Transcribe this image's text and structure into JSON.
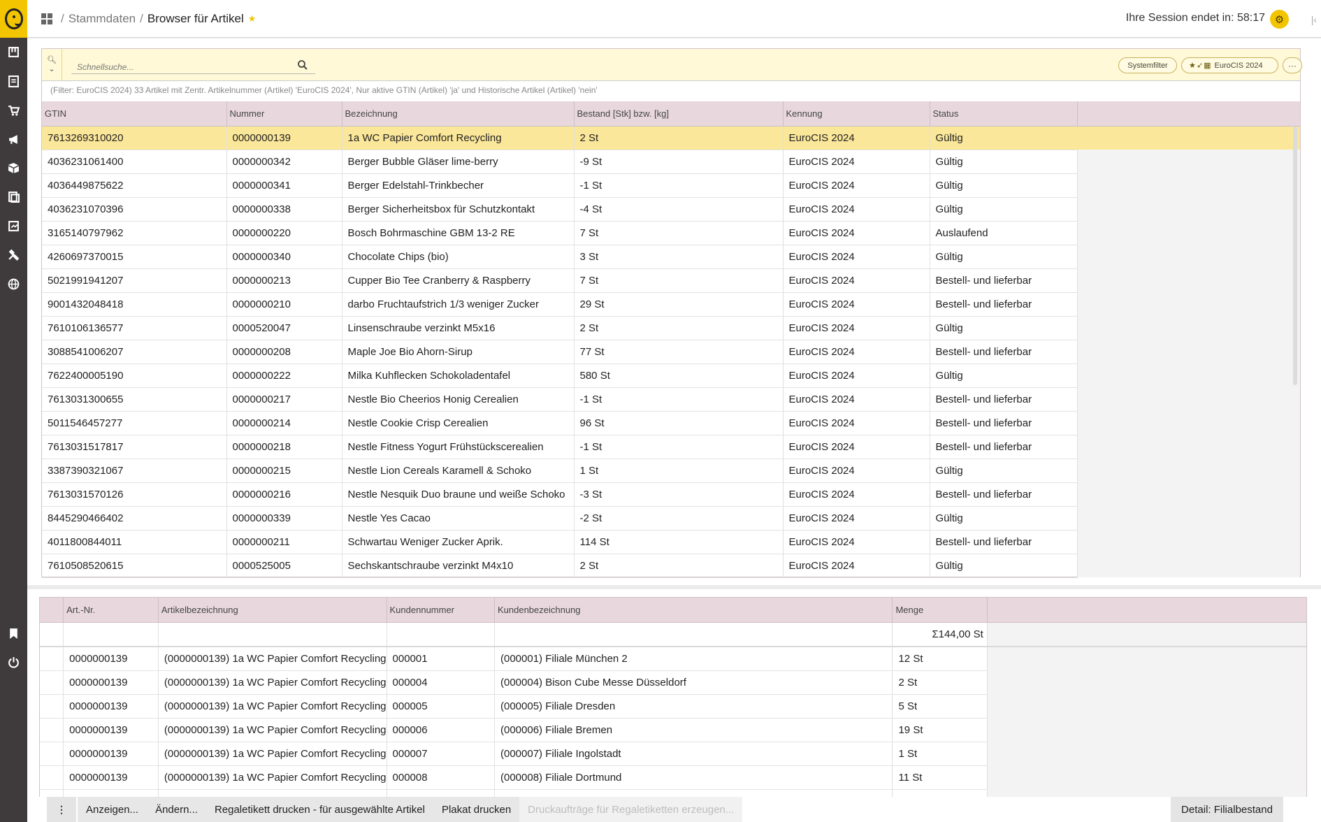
{
  "breadcrumb": {
    "section": "Stammdaten",
    "current": "Browser für Artikel"
  },
  "session": {
    "label": "Ihre Session endet in: 58:17"
  },
  "search": {
    "placeholder": "Schnellsuche..."
  },
  "filter_chips": {
    "systemfilter": "Systemfilter",
    "saved_filter": "EuroCIS 2024",
    "more": "···"
  },
  "filter_info": "(Filter: EuroCIS 2024) 33 Artikel mit Zentr. Artikelnummer (Artikel) 'EuroCIS 2024', Nur aktive GTIN (Artikel) 'ja' und Historische Artikel (Artikel) 'nein'",
  "articles": {
    "columns": [
      "GTIN",
      "Nummer",
      "Bezeichnung",
      "Bestand [Stk] bzw. [kg]",
      "Kennung",
      "Status"
    ],
    "rows": [
      {
        "gtin": "7613269310020",
        "nummer": "0000000139",
        "bezeichnung": "1a WC Papier Comfort Recycling",
        "bestand": "2 St",
        "kennung": "EuroCIS 2024",
        "status": "Gültig"
      },
      {
        "gtin": "4036231061400",
        "nummer": "0000000342",
        "bezeichnung": "Berger Bubble Gläser lime-berry",
        "bestand": "-9 St",
        "kennung": "EuroCIS 2024",
        "status": "Gültig"
      },
      {
        "gtin": "4036449875622",
        "nummer": "0000000341",
        "bezeichnung": "Berger Edelstahl-Trinkbecher",
        "bestand": "-1 St",
        "kennung": "EuroCIS 2024",
        "status": "Gültig"
      },
      {
        "gtin": "4036231070396",
        "nummer": "0000000338",
        "bezeichnung": "Berger Sicherheitsbox für Schutzkontakt",
        "bestand": "-4 St",
        "kennung": "EuroCIS 2024",
        "status": "Gültig"
      },
      {
        "gtin": "3165140797962",
        "nummer": "0000000220",
        "bezeichnung": "Bosch Bohrmaschine GBM 13-2 RE",
        "bestand": "7 St",
        "kennung": "EuroCIS 2024",
        "status": "Auslaufend"
      },
      {
        "gtin": "4260697370015",
        "nummer": "0000000340",
        "bezeichnung": "Chocolate Chips (bio)",
        "bestand": "3 St",
        "kennung": "EuroCIS 2024",
        "status": "Gültig"
      },
      {
        "gtin": "5021991941207",
        "nummer": "0000000213",
        "bezeichnung": "Cupper Bio Tee Cranberry & Raspberry",
        "bestand": "7 St",
        "kennung": "EuroCIS 2024",
        "status": "Bestell- und lieferbar"
      },
      {
        "gtin": "9001432048418",
        "nummer": "0000000210",
        "bezeichnung": "darbo Fruchtaufstrich 1/3 weniger Zucker",
        "bestand": "29 St",
        "kennung": "EuroCIS 2024",
        "status": "Bestell- und lieferbar"
      },
      {
        "gtin": "7610106136577",
        "nummer": "0000520047",
        "bezeichnung": "Linsenschraube verzinkt M5x16",
        "bestand": "2 St",
        "kennung": "EuroCIS 2024",
        "status": "Gültig"
      },
      {
        "gtin": "3088541006207",
        "nummer": "0000000208",
        "bezeichnung": "Maple Joe Bio Ahorn-Sirup",
        "bestand": "77 St",
        "kennung": "EuroCIS 2024",
        "status": "Bestell- und lieferbar"
      },
      {
        "gtin": "7622400005190",
        "nummer": "0000000222",
        "bezeichnung": "Milka Kuhflecken Schokoladentafel",
        "bestand": "580 St",
        "kennung": "EuroCIS 2024",
        "status": "Gültig"
      },
      {
        "gtin": "7613031300655",
        "nummer": "0000000217",
        "bezeichnung": "Nestle Bio Cheerios Honig Cerealien",
        "bestand": "-1 St",
        "kennung": "EuroCIS 2024",
        "status": "Bestell- und lieferbar"
      },
      {
        "gtin": "5011546457277",
        "nummer": "0000000214",
        "bezeichnung": "Nestle Cookie Crisp Cerealien",
        "bestand": "96 St",
        "kennung": "EuroCIS 2024",
        "status": "Bestell- und lieferbar"
      },
      {
        "gtin": "7613031517817",
        "nummer": "0000000218",
        "bezeichnung": "Nestle Fitness Yogurt Frühstückscerealien",
        "bestand": "-1 St",
        "kennung": "EuroCIS 2024",
        "status": "Bestell- und lieferbar"
      },
      {
        "gtin": "3387390321067",
        "nummer": "0000000215",
        "bezeichnung": "Nestle Lion Cereals Karamell & Schoko",
        "bestand": "1 St",
        "kennung": "EuroCIS 2024",
        "status": "Gültig"
      },
      {
        "gtin": "7613031570126",
        "nummer": "0000000216",
        "bezeichnung": "Nestle Nesquik Duo braune und weiße Schoko",
        "bestand": "-3 St",
        "kennung": "EuroCIS 2024",
        "status": "Bestell- und lieferbar"
      },
      {
        "gtin": "8445290466402",
        "nummer": "0000000339",
        "bezeichnung": "Nestle Yes Cacao",
        "bestand": "-2 St",
        "kennung": "EuroCIS 2024",
        "status": "Gültig"
      },
      {
        "gtin": "4011800844011",
        "nummer": "0000000211",
        "bezeichnung": "Schwartau Weniger Zucker Aprik.",
        "bestand": "114 St",
        "kennung": "EuroCIS 2024",
        "status": "Bestell- und lieferbar"
      },
      {
        "gtin": "7610508520615",
        "nummer": "0000525005",
        "bezeichnung": "Sechskantschraube verzinkt M4x10",
        "bestand": "2 St",
        "kennung": "EuroCIS 2024",
        "status": "Gültig"
      }
    ]
  },
  "detail": {
    "columns": [
      "",
      "Art.-Nr.",
      "Artikelbezeichnung",
      "Kundennummer",
      "Kundenbezeichnung",
      "Menge"
    ],
    "total": "Σ144,00 St",
    "rows": [
      {
        "artnr": "0000000139",
        "artikel": "(0000000139) 1a WC Papier Comfort Recycling",
        "kdnr": "000001",
        "kunde": "(000001) Filiale München 2",
        "menge": "12 St"
      },
      {
        "artnr": "0000000139",
        "artikel": "(0000000139) 1a WC Papier Comfort Recycling",
        "kdnr": "000004",
        "kunde": "(000004) Bison Cube Messe Düsseldorf",
        "menge": "2 St"
      },
      {
        "artnr": "0000000139",
        "artikel": "(0000000139) 1a WC Papier Comfort Recycling",
        "kdnr": "000005",
        "kunde": "(000005) Filiale Dresden",
        "menge": "5 St"
      },
      {
        "artnr": "0000000139",
        "artikel": "(0000000139) 1a WC Papier Comfort Recycling",
        "kdnr": "000006",
        "kunde": "(000006) Filiale Bremen",
        "menge": "19 St"
      },
      {
        "artnr": "0000000139",
        "artikel": "(0000000139) 1a WC Papier Comfort Recycling",
        "kdnr": "000007",
        "kunde": "(000007) Filiale Ingolstadt",
        "menge": "1 St"
      },
      {
        "artnr": "0000000139",
        "artikel": "(0000000139) 1a WC Papier Comfort Recycling",
        "kdnr": "000008",
        "kunde": "(000008) Filiale Dortmund",
        "menge": "11 St"
      },
      {
        "artnr": "",
        "artikel": "",
        "kdnr": "",
        "kunde": "",
        "menge": ""
      }
    ]
  },
  "footer": {
    "more": "⋮",
    "actions": [
      {
        "label": "Anzeigen...",
        "enabled": true
      },
      {
        "label": "Ändern...",
        "enabled": true
      },
      {
        "label": "Regaletikett drucken - für ausgewählte Artikel",
        "enabled": true
      },
      {
        "label": "Plakat drucken",
        "enabled": true
      },
      {
        "label": "Druckaufträge für Regaletiketten erzeugen...",
        "enabled": false
      }
    ],
    "detail_button": "Detail: Filialbestand"
  },
  "nav": {
    "icons": [
      "shelf-icon",
      "document-list-icon",
      "cart-icon",
      "megaphone-icon",
      "package-icon",
      "book-icon",
      "report-icon",
      "tools-icon",
      "globe-icon",
      "bookmark-icon",
      "power-icon"
    ]
  },
  "colors": {
    "accent": "#f2c500",
    "nav_bg": "#3f3a3b",
    "header_bg": "#e8d8dd",
    "selected_row": "#fbe79a",
    "searchbar_bg": "#fff9d7"
  }
}
